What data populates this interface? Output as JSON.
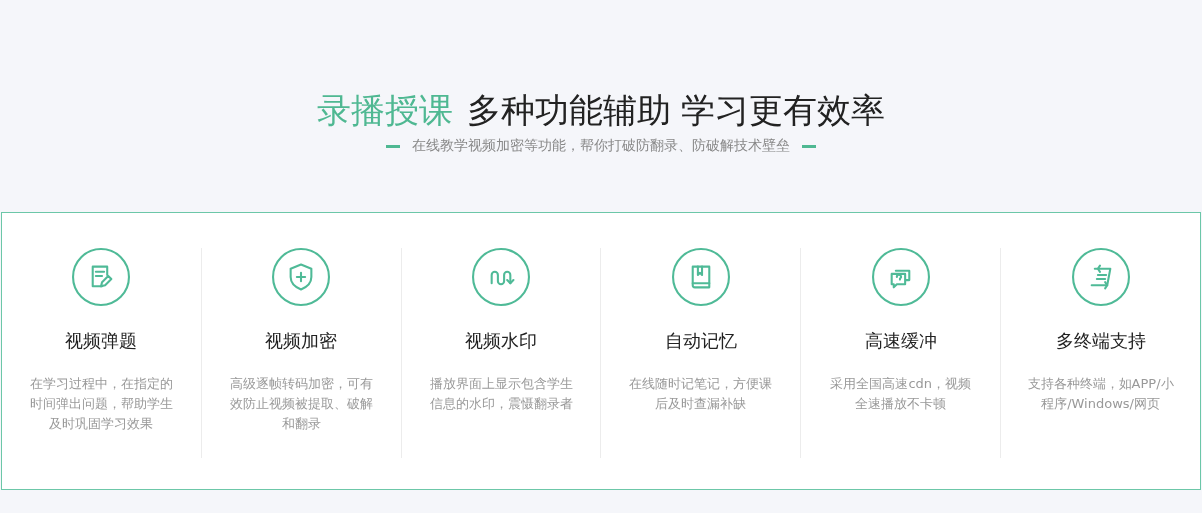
{
  "heading": {
    "highlight": "录播授课",
    "rest": "多种功能辅助 学习更有效率"
  },
  "subtitle": "在线教学视频加密等功能，帮你打破防翻录、防破解技术壁垒",
  "features": [
    {
      "kind": "quiz",
      "title": "视频弹题",
      "description": "在学习过程中，在指定的时间弹出问题，帮助学生及时巩固学习效果"
    },
    {
      "kind": "shield",
      "title": "视频加密",
      "description": "高级逐帧转码加密，可有效防止视频被提取、破解和翻录"
    },
    {
      "kind": "wave",
      "title": "视频水印",
      "description": "播放界面上显示包含学生信息的水印，震慑翻录者"
    },
    {
      "kind": "book",
      "title": "自动记忆",
      "description": "在线随时记笔记，方便课后及时查漏补缺"
    },
    {
      "kind": "chat",
      "title": "高速缓冲",
      "description": "采用全国高速cdn，视频全速播放不卡顿"
    },
    {
      "kind": "sync",
      "title": "多终端支持",
      "description": "支持各种终端，如APP/小程序/Windows/网页"
    }
  ]
}
